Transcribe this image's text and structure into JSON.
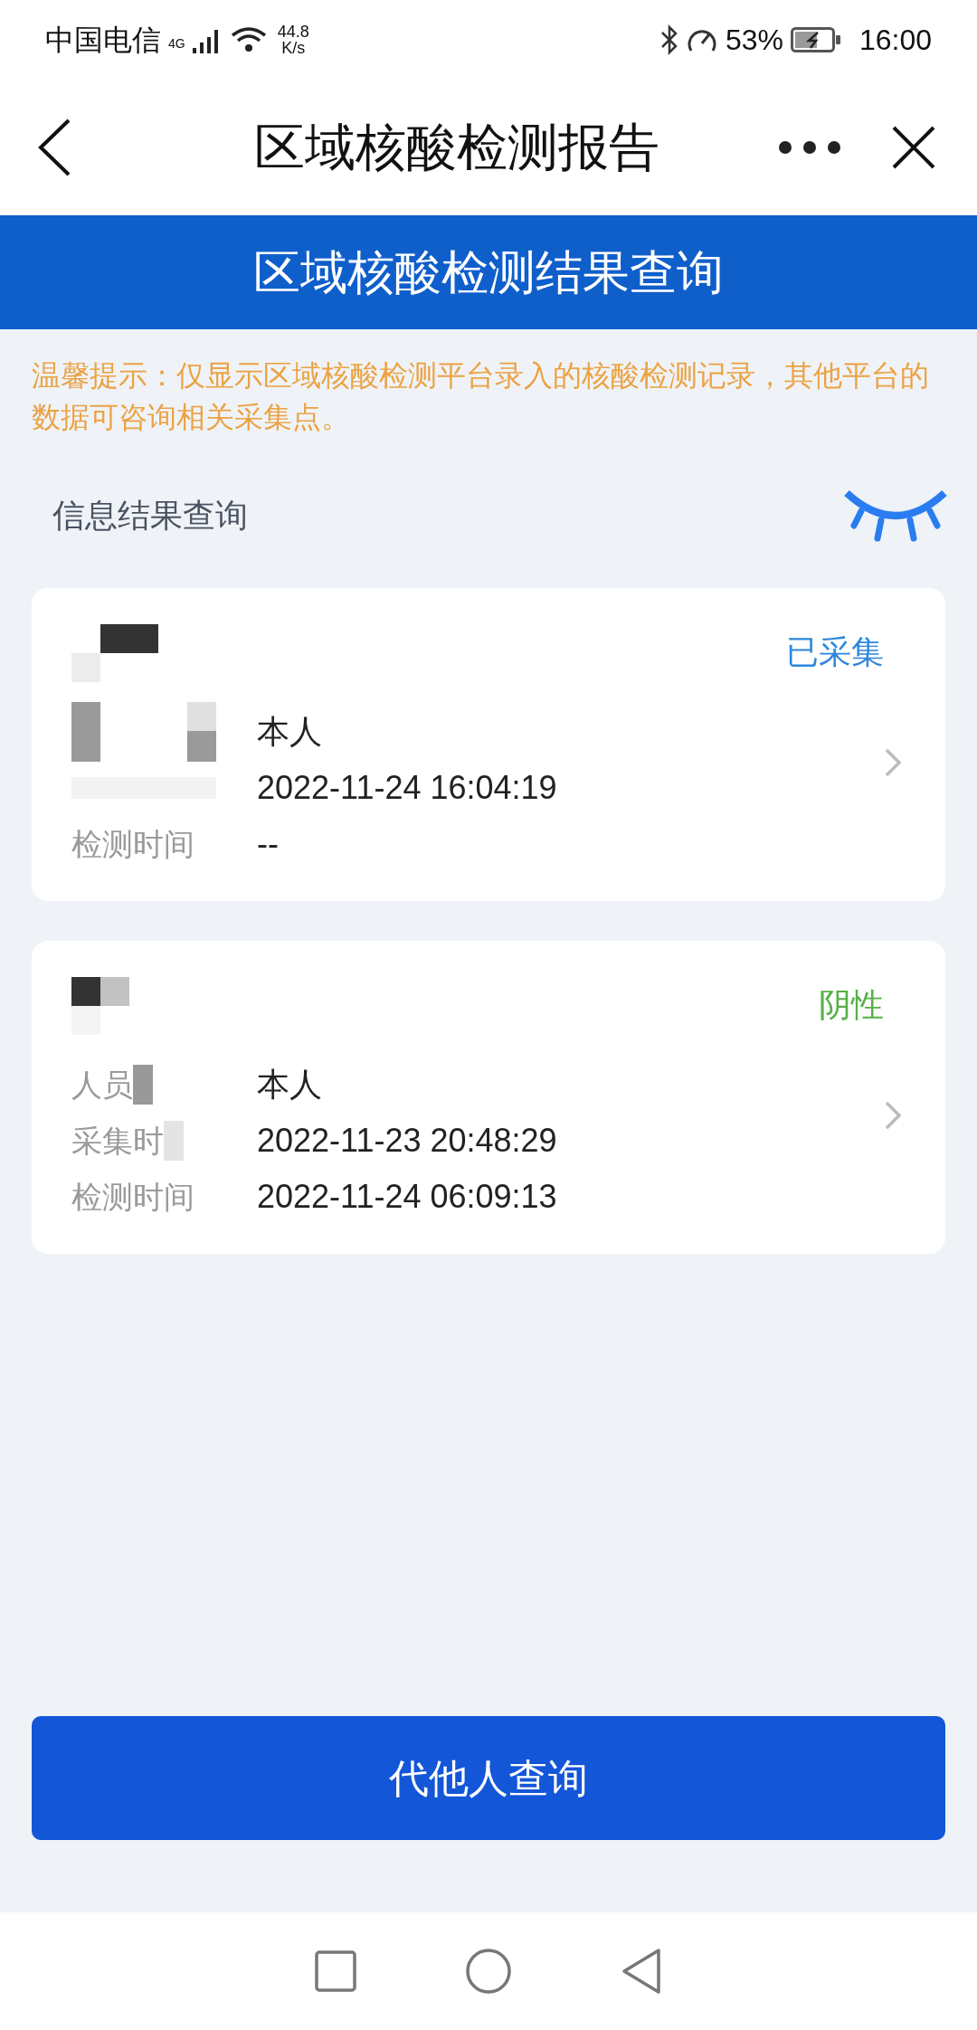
{
  "status_bar": {
    "carrier": "中国电信",
    "network": "4G",
    "speed_value": "44.8",
    "speed_unit": "K/s",
    "battery": "53%",
    "time": "16:00"
  },
  "nav": {
    "title": "区域核酸检测报告"
  },
  "banner": {
    "title": "区域核酸检测结果查询"
  },
  "tip": "温馨提示：仅显示区域核酸检测平台录入的核酸检测记录，其他平台的数据可咨询相关采集点。",
  "section": {
    "title": "信息结果查询"
  },
  "cards": [
    {
      "status": "已采集",
      "color": "#2e87dc",
      "rows": [
        {
          "label": "",
          "value": "本人"
        },
        {
          "label": "",
          "value": "2022-11-24 16:04:19"
        },
        {
          "label": "检测时间",
          "value": "--"
        }
      ]
    },
    {
      "status": "阴性",
      "color": "#55b045",
      "rows": [
        {
          "label": "人员",
          "value": "本人"
        },
        {
          "label": "采集时",
          "value": "2022-11-23 20:48:29"
        },
        {
          "label": "检测时间",
          "value": "2022-11-24 06:09:13"
        }
      ]
    }
  ],
  "button": "代他人查询"
}
